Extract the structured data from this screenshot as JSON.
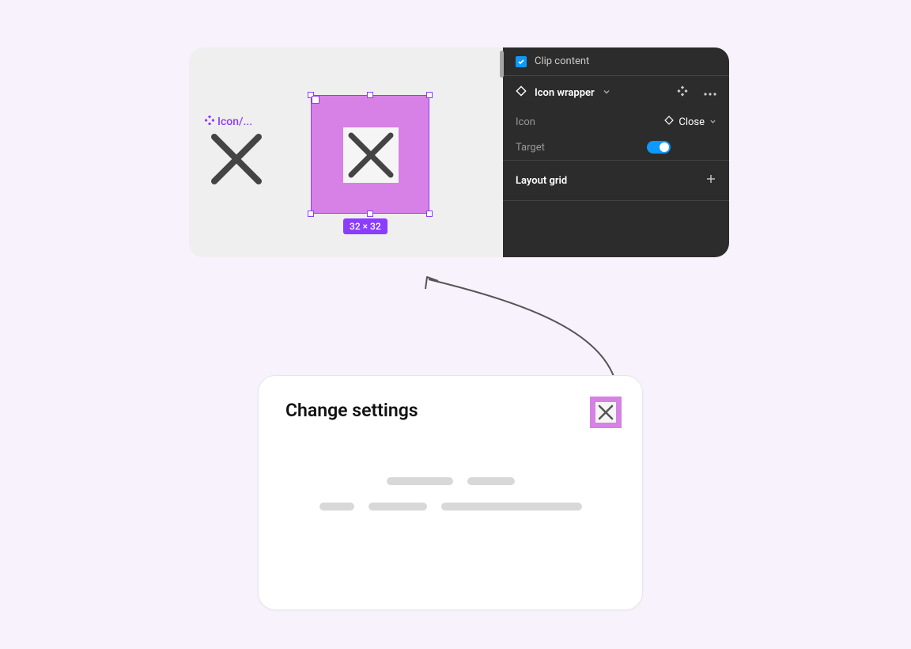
{
  "canvas": {
    "layer_label": "Icon/...",
    "dimensions_label": "32 × 32"
  },
  "properties": {
    "clip_content_label": "Clip content",
    "clip_content_checked": true,
    "component_name": "Icon wrapper",
    "fields": {
      "icon_label": "Icon",
      "icon_value": "Close",
      "target_label": "Target",
      "target_on": true
    },
    "layout_grid_label": "Layout grid"
  },
  "dialog": {
    "title": "Change settings"
  },
  "colors": {
    "selection": "#8b3dff",
    "magenta_fill": "#d780e6",
    "accent_blue": "#0d99ff"
  }
}
